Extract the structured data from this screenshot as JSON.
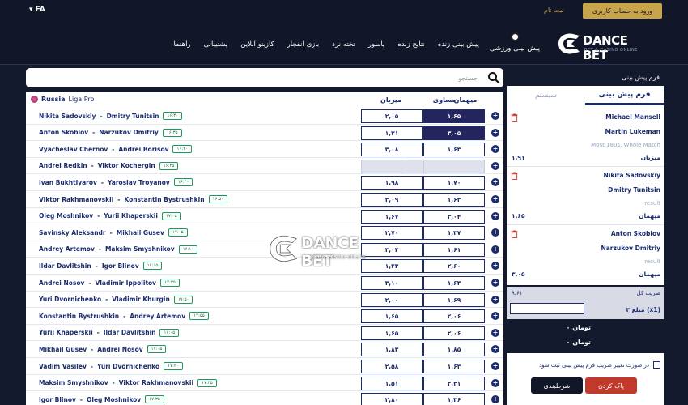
{
  "header": {
    "lang": "FA",
    "login_label": "ورود به حساب کاربری",
    "signup_label": "ثبت نام"
  },
  "nav": {
    "logo_text": "DANCE BET",
    "logo_sub": "BET & CASINO ONLINE",
    "sport_label": "پیش بینی ورزشی",
    "items": [
      "پیش بینی زنده",
      "نتایج زنده",
      "پاسور",
      "تخته نرد",
      "بازی انفجار",
      "کازینو آنلاین",
      "پشتیبانی",
      "راهنما"
    ]
  },
  "search": {
    "placeholder": "جستجو"
  },
  "league": {
    "country": "Russia",
    "name": "Liga Pro"
  },
  "columns": {
    "home": "میهمان",
    "draw": "مساوی",
    "away": "میزبان"
  },
  "matches": [
    {
      "p1": "Nikita Sadovskiy",
      "p2": "Dmitry Tunitsin",
      "time": "۱۶:۳۰",
      "h": "۱,۶۵",
      "a": "۲,۰۵",
      "sel": true
    },
    {
      "p1": "Anton Skoblov",
      "p2": "Narzukov Dmitriy",
      "time": "۱۶:۳۵",
      "h": "۳,۰۵",
      "a": "۱,۳۱",
      "sel": true
    },
    {
      "p1": "Vyacheslav Chernov",
      "p2": "Andrei Borisov",
      "time": "۱۶:۴۰",
      "h": "۱,۶۳",
      "a": "۳,۰۸",
      "sel": false
    },
    {
      "p1": "Andrei Redkin",
      "p2": "Viktor Kochergin",
      "time": "۱۶:۴۵",
      "h": "",
      "a": "",
      "sel": false,
      "empty": true
    },
    {
      "p1": "Ivan Bukhtiyarov",
      "p2": "Yaroslav Troyanov",
      "time": "۱۶:۴۰",
      "h": "۱,۷۰",
      "a": "۱,۹۸",
      "sel": false
    },
    {
      "p1": "Viktor Rakhmanovskii",
      "p2": "Konstantin Bystrushkin",
      "time": "۱۶:۵۰",
      "h": "۱,۶۳",
      "a": "۳,۰۹",
      "sel": false
    },
    {
      "p1": "Oleg Moshnikov",
      "p2": "Yurii Khaperskii",
      "time": "۱۷:۰۵",
      "h": "۳,۰۴",
      "a": "۱,۶۷",
      "sel": false
    },
    {
      "p1": "Savinsky Aleksandr",
      "p2": "Mikhail Gusev",
      "time": "۱۷:۰۵",
      "h": "۱,۳۷",
      "a": "۲,۷۰",
      "sel": false
    },
    {
      "p1": "Andrey Artemov",
      "p2": "Maksim Smyshnikov",
      "time": "۱۷:۱۰",
      "h": "۱,۶۱",
      "a": "۳,۰۳",
      "sel": false
    },
    {
      "p1": "Ildar Davlitshin",
      "p2": "Igor Blinov",
      "time": "۱۷:۱۵",
      "h": "۲,۶۰",
      "a": "۱,۴۳",
      "sel": false
    },
    {
      "p1": "Andrei Nosov",
      "p2": "Vladimir Ippolitov",
      "time": "۱۷:۳۵",
      "h": "۱,۶۳",
      "a": "۳,۱۰",
      "sel": false
    },
    {
      "p1": "Yuri Dvornichenko",
      "p2": "Vladimir Khurgin",
      "time": "۱۷:۵۰",
      "h": "۱,۶۹",
      "a": "۲,۰۰",
      "sel": false
    },
    {
      "p1": "Konstantin Bystrushkin",
      "p2": "Andrey Artemov",
      "time": "۱۷:۵۵",
      "h": "۲,۰۶",
      "a": "۱,۶۵",
      "sel": false
    },
    {
      "p1": "Yurii Khaperskii",
      "p2": "Ildar Davlitshin",
      "time": "۱۷:۰۵",
      "h": "۲,۰۶",
      "a": "۱,۶۵",
      "sel": false
    },
    {
      "p1": "Mikhail Gusev",
      "p2": "Andrei Nosov",
      "time": "۱۷:۰۵",
      "h": "۱,۸۵",
      "a": "۱,۸۳",
      "sel": false
    },
    {
      "p1": "Vadim Vasilev",
      "p2": "Yuri Dvornichenko",
      "time": "۱۷:۲۰",
      "h": "۱,۶۳",
      "a": "۲,۵۸",
      "sel": false
    },
    {
      "p1": "Maksim Smyshnikov",
      "p2": "Viktor Rakhmanovskii",
      "time": "۱۷:۲۵",
      "h": "۲,۳۱",
      "a": "۱,۵۱",
      "sel": false
    },
    {
      "p1": "Igor Blinov",
      "p2": "Oleg Moshnikov",
      "time": "۱۷:۳۵",
      "h": "۱,۳۶",
      "a": "۲,۸۰",
      "sel": false
    }
  ],
  "watermark": {
    "text": "DANCE BET",
    "sub": "BET & CASINO ONLINE"
  },
  "slip": {
    "title": "فرم پیش بینی",
    "tab_active": "فرم پیش بینی",
    "tab_inactive": "سیستم",
    "bets": [
      {
        "l1": "Michael Mansell",
        "l2": "Martin Lukeman",
        "l3": "Most 180s, Whole Match",
        "label": "میزبان",
        "odd": "۱,۹۱"
      },
      {
        "l1": "Nikita Sadovskiy",
        "l2": "Dmitry Tunitsin",
        "l3": "result",
        "label": "میهمان",
        "odd": "۱,۶۵"
      },
      {
        "l1": "Anton Skoblov",
        "l2": "Narzukov Dmitriy",
        "l3": "result",
        "label": "میهمان",
        "odd": "۳,۰۵"
      }
    ],
    "multi_label": "ضریب کل",
    "multi_value": "۹.۶۱",
    "multi_row": "۳ مبلغ (x1)",
    "sum1": "تومان ۰",
    "sum2": "تومان ۰",
    "confirm_text": "در صورت تغییر ضریب فرم پیش بینی ثبت شود",
    "clear_label": "پاک کردن",
    "bet_label": "شرطبندی"
  }
}
